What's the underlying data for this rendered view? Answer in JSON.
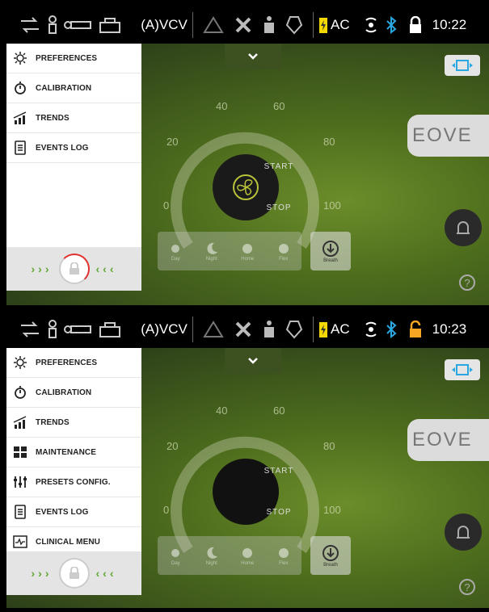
{
  "screens": [
    {
      "status": {
        "mode": "(A)VCV",
        "power": "AC",
        "time": "10:22",
        "lock": "locked"
      },
      "menu": [
        {
          "label": "PREFERENCES",
          "icon": "sun-icon"
        },
        {
          "label": "CALIBRATION",
          "icon": "timer-icon"
        },
        {
          "label": "TRENDS",
          "icon": "trends-icon"
        },
        {
          "label": "EVENTS LOG",
          "icon": "log-icon"
        }
      ],
      "dial": {
        "ticks": [
          "0",
          "20",
          "40",
          "60",
          "80",
          "100"
        ],
        "start": "START",
        "stop": "STOP"
      },
      "presets": [
        "Day",
        "Night",
        "Home",
        "Flex"
      ],
      "breath": "Breath",
      "brand": "EOVE"
    },
    {
      "status": {
        "mode": "(A)VCV",
        "power": "AC",
        "time": "10:23",
        "lock": "unlocked"
      },
      "menu": [
        {
          "label": "PREFERENCES",
          "icon": "sun-icon"
        },
        {
          "label": "CALIBRATION",
          "icon": "timer-icon"
        },
        {
          "label": "TRENDS",
          "icon": "trends-icon"
        },
        {
          "label": "MAINTENANCE",
          "icon": "maintenance-icon"
        },
        {
          "label": "PRESETS CONFIG.",
          "icon": "sliders-icon"
        },
        {
          "label": "EVENTS LOG",
          "icon": "log-icon"
        },
        {
          "label": "CLINICAL MENU",
          "icon": "waveform-icon"
        }
      ],
      "dial": {
        "ticks": [
          "0",
          "20",
          "40",
          "60",
          "80",
          "100"
        ],
        "start": "START",
        "stop": "STOP"
      },
      "presets": [
        "Day",
        "Night",
        "Home",
        "Flex"
      ],
      "breath": "Breath",
      "brand": "EOVE"
    }
  ],
  "colors": {
    "accent_green": "#5fa833",
    "bluetooth": "#29a7e1",
    "battery": "#f5d800",
    "unlock": "#f5a623",
    "lock_ring": "#e03030"
  }
}
